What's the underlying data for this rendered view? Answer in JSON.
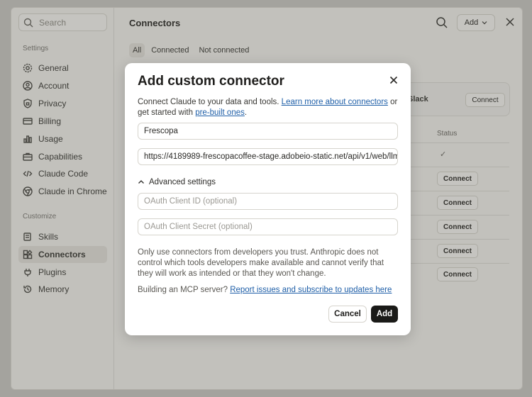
{
  "sidebar": {
    "search_placeholder": "Search",
    "settings_label": "Settings",
    "settings_items": [
      {
        "label": "General",
        "icon": "gear-icon"
      },
      {
        "label": "Account",
        "icon": "user-circle-icon"
      },
      {
        "label": "Privacy",
        "icon": "shield-icon"
      },
      {
        "label": "Billing",
        "icon": "credit-card-icon"
      },
      {
        "label": "Usage",
        "icon": "bar-chart-icon"
      },
      {
        "label": "Capabilities",
        "icon": "briefcase-icon"
      },
      {
        "label": "Claude Code",
        "icon": "code-icon"
      },
      {
        "label": "Claude in Chrome",
        "icon": "chrome-icon"
      }
    ],
    "customize_label": "Customize",
    "customize_items": [
      {
        "label": "Skills",
        "icon": "skills-icon"
      },
      {
        "label": "Connectors",
        "icon": "connectors-icon",
        "active": true
      },
      {
        "label": "Plugins",
        "icon": "plug-icon"
      },
      {
        "label": "Memory",
        "icon": "memory-icon"
      }
    ]
  },
  "header": {
    "title": "Connectors",
    "add_label": "Add"
  },
  "tabs": [
    "All",
    "Connected",
    "Not connected"
  ],
  "slack_card": {
    "name": "Slack",
    "connect_label": "Connect"
  },
  "table": {
    "status_header": "Status",
    "status_check": "✓",
    "row_connect_label": "Connect"
  },
  "modal": {
    "title": "Add custom connector",
    "desc_prefix": "Connect Claude to your data and tools. ",
    "learn_link": "Learn more about connectors",
    "desc_mid": " or get started with ",
    "prebuilt_link": "pre-built ones",
    "desc_suffix": ".",
    "name_value": "Frescopa",
    "url_value": "https://4189989-frescopacoffee-stage.adobeio-static.net/api/v1/web/llm",
    "advanced_label": "Advanced settings",
    "client_id_placeholder": "OAuth Client ID (optional)",
    "client_secret_placeholder": "OAuth Client Secret (optional)",
    "warning": "Only use connectors from developers you trust. Anthropic does not control which tools developers make available and cannot verify that they will work as intended or that they won't change.",
    "mcp_prefix": "Building an MCP server? ",
    "mcp_link": "Report issues and subscribe to updates here",
    "cancel_label": "Cancel",
    "add_label": "Add"
  }
}
